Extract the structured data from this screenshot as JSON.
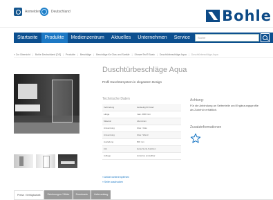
{
  "topbar": {
    "login_label": "Anmelden",
    "country_label": "Deutschland",
    "brand": "Bohle"
  },
  "nav": {
    "items": [
      "Startseite",
      "Produkte",
      "Medienzentrum",
      "Aktuelles",
      "Unternehmen",
      "Service"
    ],
    "active_index": 1,
    "search_placeholder": "Suche"
  },
  "breadcrumb": [
    "« Zur Übersicht",
    "Bohle Deutschland [DE]",
    "Produkte",
    "Beschläge",
    "Beschläge für Glas und Sanitär",
    "ShowerTec® Basic",
    "Duschtürbeschläge Aqua",
    "Duschtürbeschläge Aqua"
  ],
  "product": {
    "title": "Duschtürbeschläge Aqua",
    "subtitle": "Profil Duschtürsystem in elegantem Design"
  },
  "tech": {
    "title": "Technische Daten",
    "rows": [
      {
        "key": "Verbindung",
        "value": "beidseitig 90 Grad"
      },
      {
        "key": "Länge",
        "value": "max. 2000 mm"
      },
      {
        "key": "Material",
        "value": "Aluminium"
      },
      {
        "key": "Anwendung",
        "value": "Glas / Glas"
      },
      {
        "key": "Anwendung",
        "value": "Glas / Wand"
      },
      {
        "key": "Ausladung",
        "value": "800 mm"
      },
      {
        "key": "inkl.",
        "value": "Hebe-Senk-Funktion"
      },
      {
        "key": "Auflage",
        "value": "stufenlos einstellbar"
      }
    ]
  },
  "links": [
    "» Artikel weiterempfehlen",
    "» Seite ausdrucken"
  ],
  "attention": {
    "title": "Achtung:",
    "text_line1": "Für die Anbindung an Seitenteile und Ergänzungsprofile",
    "text_line2": "als Zubehör erhältlich."
  },
  "zusatz": {
    "title": "Zusatzinformationen"
  },
  "tabs": [
    "Preise / Verfügbarkeit",
    "Zeichnungen / Bilder",
    "Downloads",
    "Lieferumfang"
  ],
  "active_tab_index": 0,
  "colors": {
    "nav_bg": "#0c4f8f",
    "nav_active": "#1c78c4",
    "brand": "#0d4a86"
  }
}
